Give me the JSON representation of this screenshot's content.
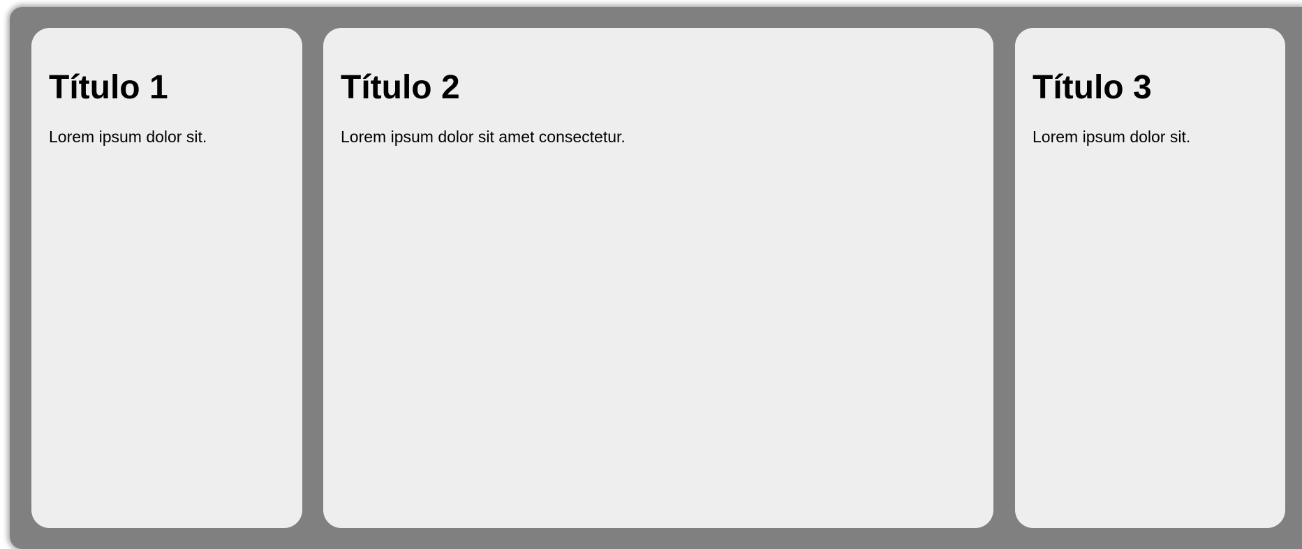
{
  "cards": [
    {
      "title": "Título 1",
      "text": "Lorem ipsum dolor sit."
    },
    {
      "title": "Título 2",
      "text": "Lorem ipsum dolor sit amet consectetur."
    },
    {
      "title": "Título 3",
      "text": "Lorem ipsum dolor sit."
    }
  ],
  "colors": {
    "container_background": "#808080",
    "card_background": "#eeeeee",
    "text": "#000000"
  }
}
